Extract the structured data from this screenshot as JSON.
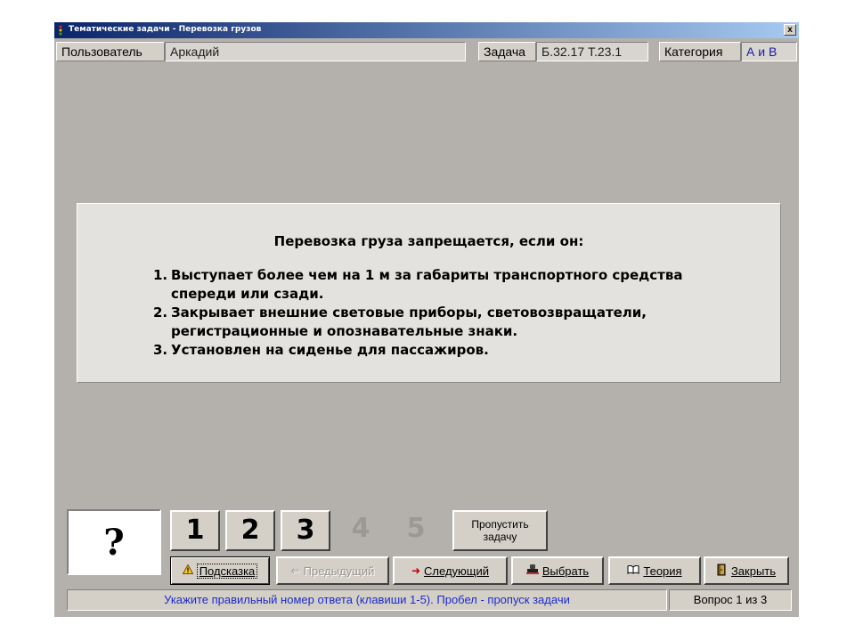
{
  "window": {
    "title": "Тематические задачи - Перевозка грузов",
    "close_glyph": "x"
  },
  "infobar": {
    "user_label": "Пользователь",
    "user_value": "Аркадий",
    "task_label": "Задача",
    "task_value": "Б.32.17  Т.23.1",
    "category_label": "Категория",
    "category_value": "А и В"
  },
  "question": {
    "title": "Перевозка груза запрещается, если он:",
    "items": [
      {
        "num": "1.",
        "line1": "Выступает более чем на 1 м за габариты транспортного средства",
        "line2": "спереди или сзади."
      },
      {
        "num": "2.",
        "line1": "Закрывает внешние световые приборы, световозвращатели,",
        "line2": "регистрационные и опознавательные знаки."
      },
      {
        "num": "3.",
        "line1": "Установлен на сиденье для пассажиров.",
        "line2": ""
      }
    ]
  },
  "answer_box": {
    "mark": "?"
  },
  "answers": [
    {
      "label": "1",
      "enabled": true
    },
    {
      "label": "2",
      "enabled": true
    },
    {
      "label": "3",
      "enabled": true
    },
    {
      "label": "4",
      "enabled": false
    },
    {
      "label": "5",
      "enabled": false
    }
  ],
  "skip_button": {
    "label": "Пропустить задачу"
  },
  "toolbar": {
    "hint": {
      "label": "Подсказка",
      "icon": "warning-icon"
    },
    "prev": {
      "label": "Предыдущий",
      "icon": "arrow-left-icon"
    },
    "next": {
      "label": "Следующий",
      "icon": "arrow-right-icon"
    },
    "choose": {
      "label": "Выбрать",
      "icon": "stamp-icon"
    },
    "theory": {
      "label": "Теория",
      "icon": "book-icon"
    },
    "close": {
      "label": "Закрыть",
      "icon": "door-exit-icon"
    }
  },
  "status": {
    "message": "Укажите правильный номер ответа (клавиши 1-5). Пробел - пропуск задачи",
    "counter": "Вопрос 1 из 3"
  },
  "colors": {
    "window_bg": "#b4b0ac",
    "title_gradient_start": "#0a246a",
    "title_gradient_end": "#a6caf0",
    "status_text": "#1c2ad0",
    "category_text": "#1a1aa8"
  }
}
